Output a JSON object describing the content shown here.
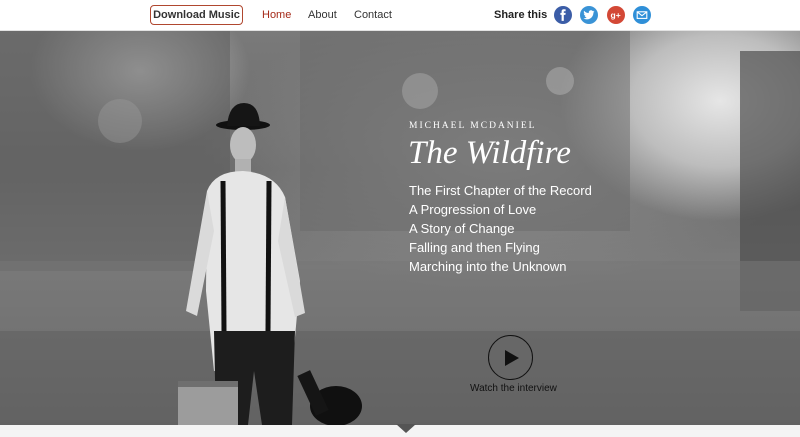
{
  "nav": {
    "download_label": "Download Music",
    "links": [
      {
        "label": "Home",
        "active": true
      },
      {
        "label": "About",
        "active": false
      },
      {
        "label": "Contact",
        "active": false
      }
    ],
    "share_label": "Share this",
    "social": [
      {
        "icon": "facebook-icon",
        "color": "#3b5da7"
      },
      {
        "icon": "twitter-icon",
        "color": "#3a93d6"
      },
      {
        "icon": "google-plus-icon",
        "color": "#d34836"
      },
      {
        "icon": "email-icon",
        "color": "#2f8fd8"
      }
    ],
    "active_color": "#a52a19",
    "download_border_color": "#b0472f"
  },
  "hero": {
    "artist": "MICHAEL MCDANIEL",
    "album": "The Wildfire",
    "tracks": [
      "The First Chapter of the Record",
      "A Progression of Love",
      "A Story of Change",
      "Falling and then Flying",
      "Marching into the Unknown"
    ],
    "watch_label": "Watch the interview",
    "play_icon": "play-icon"
  },
  "bottom": {
    "arrow_icon": "chevron-down-icon"
  }
}
